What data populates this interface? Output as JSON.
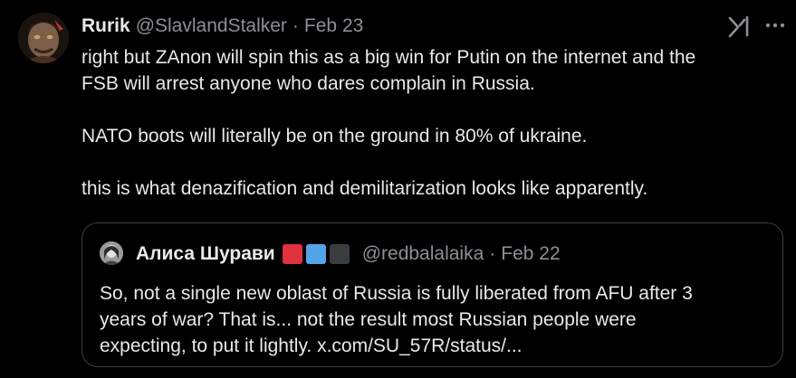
{
  "tweet": {
    "author": {
      "name": "Rurik",
      "handle": "@SlavlandStalker",
      "separator": "·",
      "date": "Feb 23"
    },
    "body_lines": [
      "right but ZAnon will spin this as a big win for Putin on the internet and the",
      "FSB will arrest anyone who dares complain in Russia.",
      "NATO boots will literally be on the ground in 80% of ukraine.",
      "this is what denazification and demilitarization looks like apparently."
    ],
    "icons": {
      "logo": "grok-icon",
      "more": "more-icon"
    }
  },
  "quote": {
    "author": {
      "name": "Алиса Шурави",
      "handle": "@redbalalaika",
      "separator": "·",
      "date": "Feb 22"
    },
    "flag_colors": [
      "#e0313f",
      "#53a3e8",
      "#3a3d40"
    ],
    "body_lines": [
      "So, not a single new oblast of Russia is fully liberated from AFU after 3",
      "years of war? That is... not the result most Russian people were",
      "expecting, to put it lightly. x.com/SU_57R/status/..."
    ]
  },
  "colors": {
    "background": "#000000",
    "text": "#e7e9ea",
    "muted": "#8b9096",
    "border": "#3a3d40"
  }
}
